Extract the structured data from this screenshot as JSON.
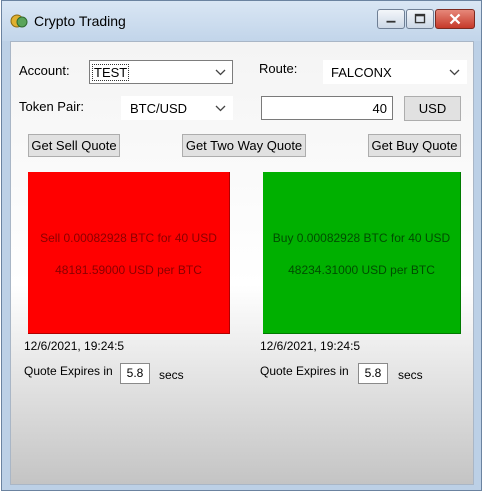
{
  "window": {
    "title": "Crypto Trading",
    "controls": {
      "minimize": "minimize-icon",
      "maximize": "maximize-icon",
      "close": "close-icon"
    }
  },
  "form": {
    "account_label": "Account:",
    "account_value": "TEST",
    "route_label": "Route:",
    "route_value": "FALCONX",
    "token_pair_label": "Token Pair:",
    "token_pair_value": "BTC/USD",
    "amount_value": "40",
    "currency_button": "USD"
  },
  "actions": {
    "sell_quote": "Get Sell Quote",
    "two_way_quote": "Get Two Way Quote",
    "buy_quote": "Get Buy Quote"
  },
  "sell": {
    "summary": "Sell 0.00082928 BTC for 40 USD",
    "rate": "48181.59000 USD per BTC",
    "timestamp": "12/6/2021, 19:24:5",
    "expires_label": "Quote Expires in",
    "expires_value": "5.8",
    "expires_unit": "secs",
    "color": "#ff0000"
  },
  "buy": {
    "summary": "Buy 0.00082928 BTC for 40 USD",
    "rate": "48234.31000 USD per BTC",
    "timestamp": "12/6/2021, 19:24:5",
    "expires_label": "Quote Expires in",
    "expires_value": "5.8",
    "expires_unit": "secs",
    "color": "#00b000"
  }
}
